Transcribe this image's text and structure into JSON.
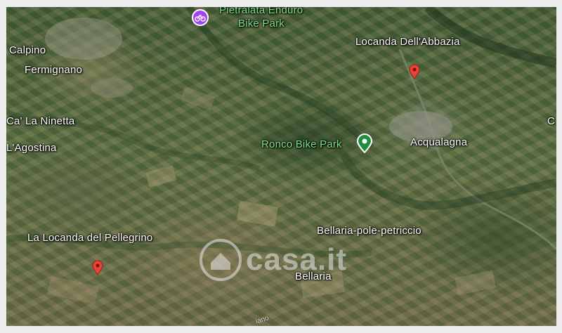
{
  "map": {
    "labels": {
      "pietralata_line1": "Pietralata Enduro",
      "pietralata_line2": "Bike Park",
      "calpino": "Calpino",
      "fermignano": "Fermignano",
      "ca_la_ninetta": "Ca' La Ninetta",
      "agostina": "L'Agostina",
      "locanda_abbazia": "Locanda Dell'Abbazia",
      "ronco": "Ronco Bike Park",
      "acqualagna": "Acqualagna",
      "bellaria_pole": "Bellaria-pole-petriccio",
      "locanda_pellegrino": "La Locanda del Pellegrino",
      "bellaria": "Bellaria",
      "edge_c": "C",
      "road": "iano"
    },
    "pins": [
      {
        "name": "Pietralata Enduro Bike Park",
        "type": "bike-park",
        "color": "#a142f4"
      },
      {
        "name": "Ronco Bike Park",
        "type": "park",
        "color": "#1e8e3e"
      },
      {
        "name": "Locanda Dell'Abbazia",
        "type": "lodging",
        "color": "#ea4335"
      },
      {
        "name": "La Locanda del Pellegrino",
        "type": "lodging",
        "color": "#ea4335"
      }
    ]
  },
  "watermark": {
    "text": "casa.it"
  }
}
